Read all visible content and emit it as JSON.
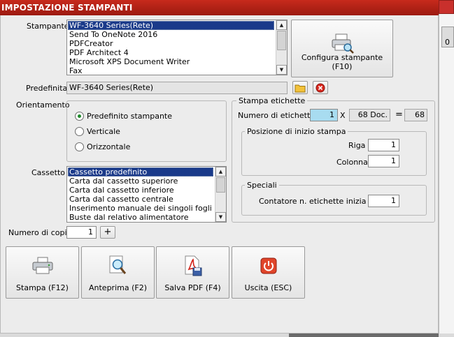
{
  "window": {
    "title": "IMPOSTAZIONE STAMPANTI",
    "strip_text": "0"
  },
  "stampante": {
    "label": "Stampante",
    "items": [
      "WF-3640 Series(Rete)",
      "Send To OneNote 2016",
      "PDFCreator",
      "PDF Architect 4",
      "Microsoft XPS Document Writer",
      "Fax"
    ],
    "selected_index": 0,
    "configure_button": "Configura stampante (F10)"
  },
  "predefinita": {
    "label": "Predefinita",
    "value": "WF-3640 Series(Rete)"
  },
  "orientamento": {
    "label": "Orientamento",
    "options": [
      "Predefinito stampante",
      "Verticale",
      "Orizzontale"
    ],
    "selected_index": 0
  },
  "cassetto": {
    "label": "Cassetto",
    "items": [
      "Cassetto predefinito",
      "Carta dal cassetto superiore",
      "Carta dal cassetto inferiore",
      "Carta dal cassetto centrale",
      "Inserimento manuale dei singoli fogli",
      "Buste dal relativo alimentatore"
    ],
    "selected_index": 0
  },
  "copie": {
    "label": "Numero di copie",
    "value": "1",
    "plus": "+"
  },
  "etichette": {
    "title": "Stampa etichette",
    "numero_label": "Numero di etichette",
    "numero_value": "1",
    "x": "X",
    "doc_value": "68 Doc.",
    "eq": "=",
    "total_value": "68",
    "posizione": {
      "title": "Posizione di inizio stampa",
      "riga_label": "Riga",
      "riga_value": "1",
      "colonna_label": "Colonna",
      "colonna_value": "1"
    },
    "speciali": {
      "title": "Speciali",
      "contatore_label": "Contatore n. etichette inizia da",
      "contatore_value": "1"
    }
  },
  "buttons": {
    "stampa": "Stampa (F12)",
    "anteprima": "Anteprima (F2)",
    "salva_pdf": "Salva PDF (F4)",
    "uscita": "Uscita (ESC)"
  },
  "colors": {
    "titlebar": "#b32216",
    "selection": "#1a3a8a",
    "focus_field": "#a8dcf0"
  },
  "icons": [
    "printer-icon",
    "magnifier-icon",
    "pdf-save-icon",
    "power-icon",
    "folder-icon",
    "clear-icon",
    "close-icon"
  ]
}
